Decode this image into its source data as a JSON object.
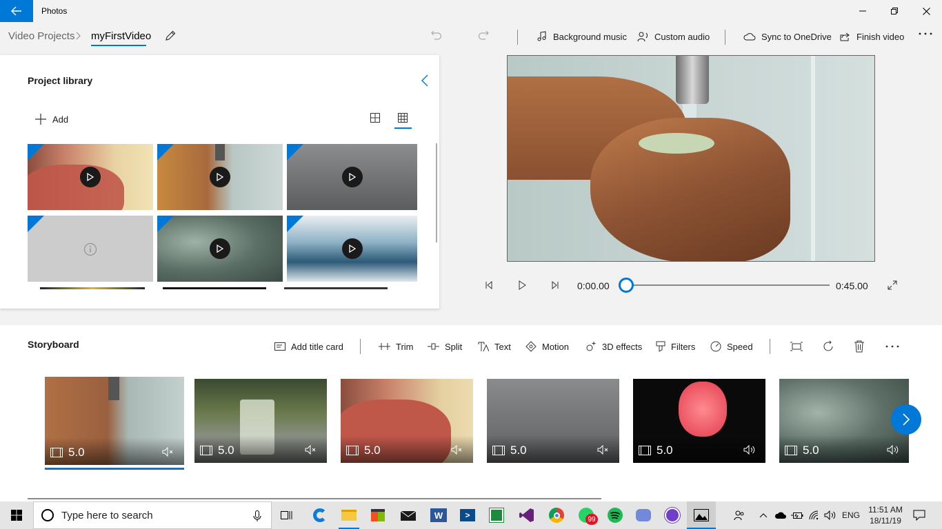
{
  "window": {
    "title": "Photos"
  },
  "breadcrumb": {
    "root": "Video Projects",
    "current": "myFirstVideo"
  },
  "commands": {
    "background_music": "Background music",
    "custom_audio": "Custom audio",
    "sync": "Sync to OneDrive",
    "finish": "Finish video"
  },
  "library": {
    "title": "Project library",
    "add_label": "Add"
  },
  "player": {
    "current_time": "0:00.00",
    "total_time": "0:45.00",
    "progress": 0
  },
  "storyboard": {
    "title": "Storyboard",
    "tools": {
      "add_title_card": "Add title card",
      "trim": "Trim",
      "split": "Split",
      "text": "Text",
      "motion": "Motion",
      "effects_3d": "3D effects",
      "filters": "Filters",
      "speed": "Speed"
    },
    "clips": [
      {
        "duration": "5.0",
        "muted": true,
        "selected": true
      },
      {
        "duration": "5.0",
        "muted": true,
        "selected": false
      },
      {
        "duration": "5.0",
        "muted": true,
        "selected": false
      },
      {
        "duration": "5.0",
        "muted": true,
        "selected": false
      },
      {
        "duration": "5.0",
        "muted": false,
        "selected": false
      },
      {
        "duration": "5.0",
        "muted": false,
        "selected": false
      }
    ]
  },
  "taskbar": {
    "search_placeholder": "Type here to search",
    "whatsapp_badge": "99",
    "language": "ENG",
    "time": "11:51 AM",
    "date": "18/11/19"
  },
  "colors": {
    "accent": "#0078d7"
  }
}
